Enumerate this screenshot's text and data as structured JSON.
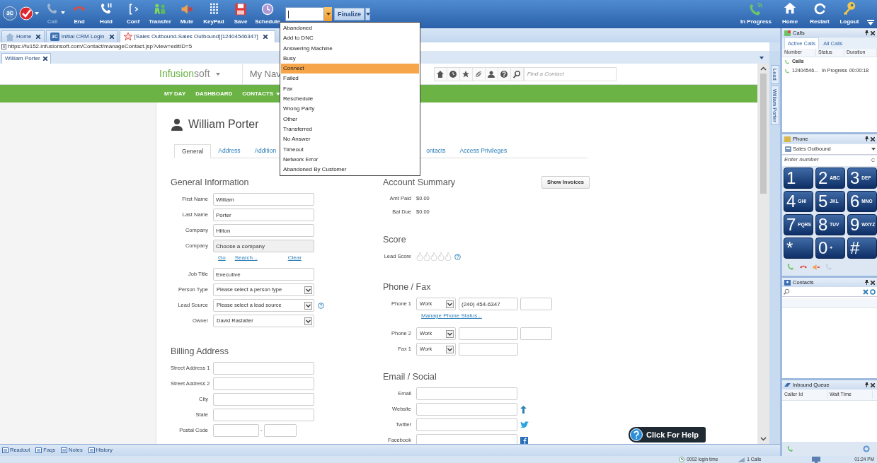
{
  "toolbar": {
    "logo": "3C",
    "buttons": [
      {
        "label": "Call",
        "disabled": true,
        "has_menu": true
      },
      {
        "label": "End",
        "disabled": false,
        "has_menu": false
      },
      {
        "label": "Hold",
        "disabled": false,
        "has_menu": false
      },
      {
        "label": "Conf",
        "disabled": false,
        "has_menu": false
      },
      {
        "label": "Transfer",
        "disabled": false,
        "has_menu": false
      },
      {
        "label": "Mute",
        "disabled": false,
        "has_menu": false
      },
      {
        "label": "KeyPad",
        "disabled": false,
        "has_menu": false
      },
      {
        "label": "Save",
        "disabled": false,
        "has_menu": false
      },
      {
        "label": "Schedule",
        "disabled": false,
        "has_menu": false
      }
    ],
    "disposition": {
      "open": true,
      "options": [
        {
          "label": "Abandoned",
          "selected": false
        },
        {
          "label": "Add to DNC",
          "selected": false
        },
        {
          "label": "Answering Machine",
          "selected": false
        },
        {
          "label": "Busy",
          "selected": false
        },
        {
          "label": "Connect",
          "selected": true
        },
        {
          "label": "Failed",
          "selected": false
        },
        {
          "label": "Fax",
          "selected": false
        },
        {
          "label": "Reschedule",
          "selected": false
        },
        {
          "label": "Wrong Party",
          "selected": false
        },
        {
          "label": "Other",
          "selected": false
        },
        {
          "label": "Transferred",
          "selected": false
        },
        {
          "label": "No Answer",
          "selected": false
        },
        {
          "label": "Timeout",
          "selected": false
        },
        {
          "label": "Network Error",
          "selected": false
        },
        {
          "label": "Abandoned By Customer",
          "selected": false
        }
      ]
    },
    "finalize": "Finalize",
    "right_buttons": [
      {
        "label": "In Progress"
      },
      {
        "label": "Home"
      },
      {
        "label": "Restart"
      },
      {
        "label": "Logout"
      }
    ]
  },
  "browser_tabs": [
    {
      "label": "Home",
      "selected": false
    },
    {
      "label": "Initial CRM Login",
      "badge": "3C",
      "selected": false
    },
    {
      "label": "[Sales Outbound-Sales Outbound][12404546347]",
      "selected": true
    }
  ],
  "url": "https://fu152.infusionsoft.com/Contact/manageContact.jsp?view=editID=5",
  "page_tabs": [
    {
      "label": "William Porter",
      "selected": true
    }
  ],
  "crm": {
    "logo": {
      "primary": "Infusion",
      "secondary": "soft"
    },
    "my_nav": "My Nav",
    "search": {
      "placeholder": "Find a Contact"
    },
    "nav": [
      "MY DAY",
      "DASHBOARD",
      "CONTACTS"
    ],
    "contact_name": "William Porter",
    "contact_tabs": [
      {
        "label": "General",
        "selected": true
      },
      {
        "label": "Address",
        "selected": false
      },
      {
        "label": "Addition",
        "selected": false
      },
      {
        "label": "ontacts",
        "selected": false
      },
      {
        "label": "Access Privileges",
        "selected": false
      }
    ],
    "general": {
      "title": "General Information",
      "fields": [
        {
          "label": "First Name",
          "kind": "text",
          "value": "William"
        },
        {
          "label": "Last Name",
          "kind": "text",
          "value": "Porter"
        },
        {
          "label": "Company",
          "kind": "text",
          "value": "Hilton"
        },
        {
          "label": "Company",
          "kind": "readonly",
          "value": "Choose a company"
        },
        {
          "kind": "links",
          "links": [
            "Go",
            "Search...",
            "Clear"
          ]
        },
        {
          "label": "Job Title",
          "kind": "text",
          "value": "Executive"
        },
        {
          "label": "Person Type",
          "kind": "select",
          "value": "Please select a person type"
        },
        {
          "label": "Lead Source",
          "kind": "select",
          "value": "Please select a lead source",
          "help": true
        },
        {
          "label": "Owner",
          "kind": "select",
          "value": "David Rastatter"
        }
      ]
    },
    "billing": {
      "title": "Billing Address",
      "fields": [
        {
          "label": "Street Address 1",
          "kind": "text"
        },
        {
          "label": "Street Address 2",
          "kind": "text"
        },
        {
          "label": "City",
          "kind": "text"
        },
        {
          "label": "State",
          "kind": "text"
        },
        {
          "label": "Postal Code",
          "kind": "postal",
          "separator": "-"
        }
      ]
    },
    "account": {
      "title": "Account Summary",
      "button": "Show Invoices",
      "rows": [
        {
          "label": "Amt Paid",
          "value": "$0.00"
        },
        {
          "label": "Bal Due",
          "value": "$0.00"
        }
      ]
    },
    "score": {
      "title": "Score",
      "label": "Lead Score",
      "stars": 0
    },
    "phone_fax": {
      "title": "Phone / Fax",
      "rows": [
        {
          "label": "Phone 1",
          "type": "Work",
          "number": "(240) 454-6347",
          "has_ext": true
        },
        {
          "kind": "link",
          "text": "Manage Phone Status..."
        },
        {
          "label": "Phone 2",
          "type": "Work",
          "has_ext": true
        },
        {
          "label": "Fax 1",
          "type": "Work",
          "has_ext": false
        }
      ]
    },
    "email_social": {
      "title": "Email / Social",
      "rows": [
        {
          "label": "Email"
        },
        {
          "label": "Website",
          "kind": "website"
        },
        {
          "label": "Twitter",
          "kind": "twitter"
        },
        {
          "label": "Facebook",
          "kind": "facebook"
        }
      ]
    }
  },
  "help_button": "Click For Help",
  "side_tabs": [
    {
      "label": "Lead"
    },
    {
      "label": "William Porter"
    }
  ],
  "calls_pane": {
    "title": "Calls",
    "tabs": [
      {
        "label": "Active Calls",
        "selected": true
      },
      {
        "label": "All Calls",
        "selected": false
      }
    ],
    "columns": [
      "Number",
      "Status",
      "Duration"
    ],
    "group": "Calls",
    "rows": [
      {
        "number": "12404546...",
        "status": "In Progress",
        "duration": "00:00:18"
      }
    ]
  },
  "phone_pane": {
    "title": "Phone",
    "line": "Sales Outbound",
    "input": {
      "placeholder": "Enter number"
    },
    "clear": "C",
    "keys": [
      {
        "digit": "1"
      },
      {
        "digit": "2",
        "letters": "ABC"
      },
      {
        "digit": "3",
        "letters": "DEF"
      },
      {
        "digit": "4",
        "letters": "GHI"
      },
      {
        "digit": "5",
        "letters": "JKL"
      },
      {
        "digit": "6",
        "letters": "MNO"
      },
      {
        "digit": "7",
        "letters": "PQRS"
      },
      {
        "digit": "8",
        "letters": "TUV"
      },
      {
        "digit": "9",
        "letters": "WXYZ"
      },
      {
        "digit": "*"
      },
      {
        "digit": "0",
        "letters": "+"
      },
      {
        "digit": "#"
      }
    ]
  },
  "contacts_pane": {
    "title": "Contacts"
  },
  "queue_pane": {
    "title": "Inbound Queue",
    "columns": [
      "Caller Id",
      "Wait Time"
    ]
  },
  "bottom_tabs": [
    {
      "label": "Readout"
    },
    {
      "label": "Faqs"
    },
    {
      "label": "Notes"
    },
    {
      "label": "History"
    }
  ],
  "status_bar": {
    "login_time": "0002 login time",
    "calls": "1 Calls",
    "clock": "01:24 PM"
  }
}
